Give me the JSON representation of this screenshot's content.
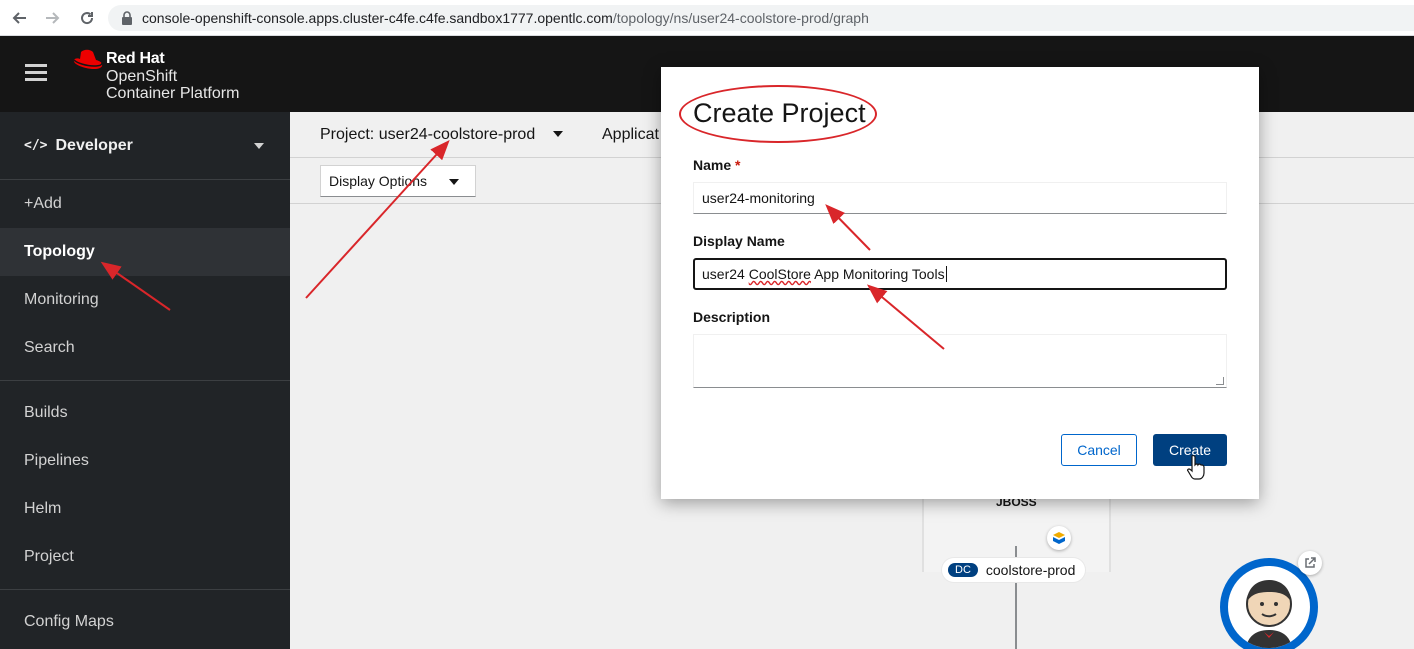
{
  "browser": {
    "url_host": "console-openshift-console.apps.cluster-c4fe.c4fe.sandbox1777.opentlc.com",
    "url_path": "/topology/ns/user24-coolstore-prod/graph"
  },
  "masthead": {
    "brand_company": "Red Hat",
    "brand_product_line1": "OpenShift",
    "brand_product_line2": "Container Platform"
  },
  "sidebar": {
    "perspective": "Developer",
    "items": [
      {
        "label": "+Add"
      },
      {
        "label": "Topology"
      },
      {
        "label": "Monitoring"
      },
      {
        "label": "Search"
      },
      {
        "label": "Builds"
      },
      {
        "label": "Pipelines"
      },
      {
        "label": "Helm"
      },
      {
        "label": "Project"
      },
      {
        "label": "Config Maps"
      }
    ]
  },
  "content": {
    "project_selector": "Project: user24-coolstore-prod",
    "application_selector": "Applicat",
    "display_options": "Display Options",
    "node_icon_text": "JBOSS",
    "node_badge": "DC",
    "node_name": "coolstore-prod"
  },
  "modal": {
    "title": "Create Project",
    "name_label": "Name",
    "required_mark": "*",
    "name_value": "user24-monitoring",
    "display_name_label": "Display Name",
    "display_name_prefix": "user24 ",
    "display_name_misspelled": "CoolStore",
    "display_name_suffix": " App Monitoring Tools",
    "description_label": "Description",
    "cancel_label": "Cancel",
    "create_label": "Create"
  },
  "colors": {
    "masthead": "#151515",
    "sidebar": "#212427",
    "primary": "#004080",
    "link": "#0066cc",
    "annotation": "#d9262a"
  }
}
